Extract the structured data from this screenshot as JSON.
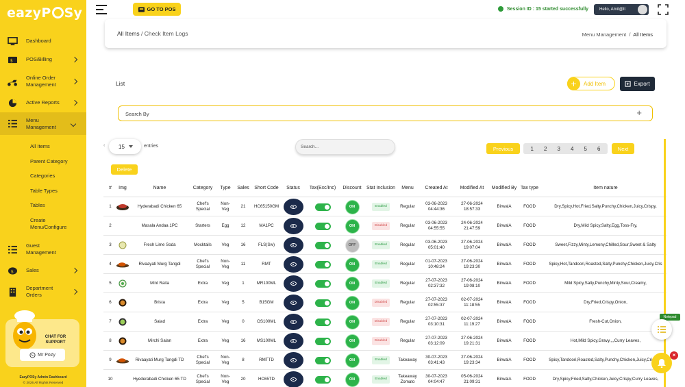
{
  "brand": {
    "logo_text": "eazyPOSy",
    "accent_color": "#f9d21c",
    "dark_color": "#1f2a38"
  },
  "sidebar": {
    "items": [
      {
        "label": "Dashboard",
        "icon": "monitor-icon"
      },
      {
        "label": "POS/Billing",
        "icon": "billing-icon"
      },
      {
        "label": "Online Order Management",
        "icon": "delivery-scooter-icon"
      },
      {
        "label": "Active Reports",
        "icon": "reports-icon"
      },
      {
        "label": "Menu Management",
        "icon": "menu-list-icon"
      },
      {
        "label": "Guest Management",
        "icon": "guest-list-icon"
      },
      {
        "label": "Sales",
        "icon": "sales-icon"
      },
      {
        "label": "Department Orders",
        "icon": "building-icon"
      }
    ],
    "sub_items": [
      "All Items",
      "Parent Category",
      "Categories",
      "Table Types",
      "Tables",
      "Create Menu/Configure"
    ],
    "support": {
      "chat_label": "CHAT FOR SUPPORT",
      "button_label": "Mr Pozy"
    },
    "footer_title": "EazyPOSy Admin Dashboard",
    "footer_copyright": "© 2026 All Rights Reserved"
  },
  "topbar": {
    "goto_pos_label": "GO TO POS",
    "session_text": "Session ID : 15 started successfully",
    "user_label": "Hello, Amit@It"
  },
  "header": {
    "crumb_root": "All Items",
    "crumb_sep": "/",
    "crumb_current": "Check Item Logs",
    "right_root": "Menu Management",
    "right_sep": "/",
    "right_current": "All Items"
  },
  "list": {
    "title": "List",
    "add_label": "Add Item",
    "export_label": "Export",
    "search_by_label": "Search By",
    "entries_value": "15",
    "entries_label": "entries",
    "search_placeholder": "Search...",
    "prev_label": "Previous",
    "next_label": "Next",
    "pages": [
      "1",
      "2",
      "3",
      "4",
      "5",
      "6"
    ],
    "delete_label": "Delete"
  },
  "table": {
    "columns": [
      "#",
      "Img",
      "Name",
      "Category",
      "Type",
      "Sales",
      "Short Code",
      "Status",
      "Tax(Exc/Inc)",
      "Discount",
      "Stat Inclusion",
      "Menu",
      "Created At",
      "Modified At",
      "Modified By",
      "Tax type",
      "Item nature"
    ],
    "rows": [
      {
        "n": "1",
        "name": "Hyderabadi Chicken 65",
        "category": "Chef's Special",
        "type": "Non-Veg",
        "sales": "21",
        "code": "HC65150GM",
        "discount": "ON",
        "stat": "Enabled",
        "menu": "Regular",
        "created": "03-06-2023 04:44:36",
        "modified": "27-06-2024 18:57:33",
        "by": "BirwalA",
        "tax": "FOOD",
        "nature": "Dry,Spicy,Hot,Fried,Salty,Punchy,Chicken,Juicy,Crispy,",
        "img": "plate"
      },
      {
        "n": "2",
        "name": "Masala Andaa 1PC",
        "category": "Starters",
        "type": "Egg",
        "sales": "12",
        "code": "MA1PC",
        "discount": "ON",
        "stat": "Disabled",
        "menu": "Regular",
        "created": "03-06-2023 04:55:55",
        "modified": "24-06-2024 21:47:59",
        "by": "BirwalA",
        "tax": "FOOD",
        "nature": "Dry,Mild Spicy,Salty,Egg,Toss-Fry,",
        "img": "none"
      },
      {
        "n": "3",
        "name": "Fresh Lime Soda",
        "category": "Mocktails",
        "type": "Veg",
        "sales": "16",
        "code": "FLS(Sw)",
        "discount": "OFF",
        "stat": "Enabled",
        "menu": "Regular",
        "created": "03-06-2023 05:01:40",
        "modified": "27-06-2024 19:07:04",
        "by": "BirwalA",
        "tax": "FOOD",
        "nature": "Sweet,Fizzy,Minty,Lemony,Chilled,Sour,Sweet & Salty",
        "img": "lime"
      },
      {
        "n": "4",
        "name": "Rivaayati Murg Tangdi",
        "category": "Chef's Special",
        "type": "Non-Veg",
        "sales": "11",
        "code": "RMT",
        "discount": "ON",
        "stat": "Enabled",
        "menu": "Regular",
        "created": "01-07-2023 10:48:24",
        "modified": "27-06-2024 19:23:30",
        "by": "BirwalA",
        "tax": "FOOD",
        "nature": "Spicy,Hot,Tandoori,Roasted,Salty,Punchy,Chicken,Juicy,Cris",
        "img": "leg"
      },
      {
        "n": "5",
        "name": "Mint Raita",
        "category": "Extra",
        "type": "Veg",
        "sales": "1",
        "code": "MR100ML",
        "discount": "ON",
        "stat": "Enabled",
        "menu": "Regular",
        "created": "27-07-2023 02:37:32",
        "modified": "27-06-2024 19:08:10",
        "by": "BirwalA",
        "tax": "FOOD",
        "nature": "Mild Spicy,Salty,Punchy,Minty,Sour,Creamy,",
        "img": "raita"
      },
      {
        "n": "6",
        "name": "Brista",
        "category": "Extra",
        "type": "Veg",
        "sales": "5",
        "code": "B15GM",
        "discount": "ON",
        "stat": "Disabled",
        "menu": "Regular",
        "created": "27-07-2023 02:55:37",
        "modified": "02-07-2024 11:18:55",
        "by": "BirwalA",
        "tax": "FOOD",
        "nature": "Dry,Fried,Crispy,Onion,",
        "img": "brista"
      },
      {
        "n": "7",
        "name": "Salad",
        "category": "Extra",
        "type": "Veg",
        "sales": "0",
        "code": "OS100ML",
        "discount": "ON",
        "stat": "Disabled",
        "menu": "Regular",
        "created": "27-07-2023 03:10:31",
        "modified": "02-07-2024 11:19:27",
        "by": "BirwalA",
        "tax": "FOOD",
        "nature": "Fresh-Cut,Onion,",
        "img": "salad"
      },
      {
        "n": "8",
        "name": "Mirchi Salan",
        "category": "Extra",
        "type": "Veg",
        "sales": "16",
        "code": "MS100ML",
        "discount": "ON",
        "stat": "Disabled",
        "menu": "Regular",
        "created": "27-07-2023 03:12:09",
        "modified": "27-06-2024 19:21:31",
        "by": "BirwalA",
        "tax": "FOOD",
        "nature": "Hot,Mild Spicy,Gravy,,,,Curry Leaves,",
        "img": "brista"
      },
      {
        "n": "9",
        "name": "Rivaayati Murg Tangdi TD",
        "category": "Chef's Special",
        "type": "Non-Veg",
        "sales": "8",
        "code": "RMTTD",
        "discount": "ON",
        "stat": "Enabled",
        "menu": "Takeaway",
        "created": "30-07-2023 03:41:43",
        "modified": "27-06-2024 19:23:34",
        "by": "BirwalA",
        "tax": "FOOD",
        "nature": "Spicy,Tandoori,Roasted,Salty,Punchy,Chicken,Juicy,Cri Mild,",
        "img": "leg"
      },
      {
        "n": "10",
        "name": "Hyederabadi Chicken 65 TD",
        "category": "Chef's Special",
        "type": "Non-Veg",
        "sales": "20",
        "code": "HC65TD",
        "discount": "ON",
        "stat": "Enabled",
        "menu": "Takeaway Zomato",
        "created": "30-07-2023 04:04:47",
        "modified": "05-06-2024 21:09:31",
        "by": "BirwalA",
        "tax": "FOOD",
        "nature": "Dry,Spicy,Fried,Salty,Chicken,Juicy,Crispy,Curry Leaves,",
        "img": "none"
      }
    ]
  },
  "widgets": {
    "notepad_label": "Notepad"
  }
}
